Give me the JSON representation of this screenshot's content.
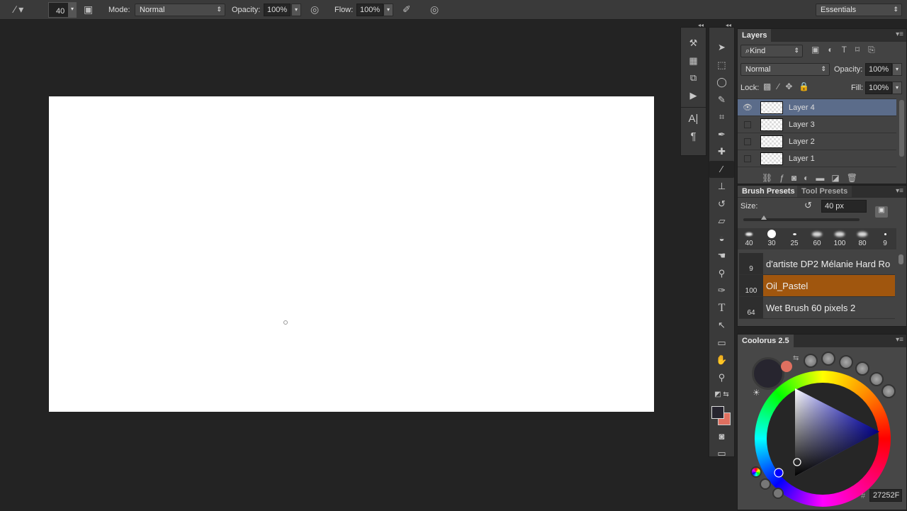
{
  "options_bar": {
    "brush_size": "40",
    "mode_label": "Mode:",
    "mode_value": "Normal",
    "opacity_label": "Opacity:",
    "opacity_value": "100%",
    "flow_label": "Flow:",
    "flow_value": "100%",
    "workspace": "Essentials"
  },
  "tools": [
    "move",
    "marquee",
    "lasso",
    "quick-selection",
    "crop",
    "eyedropper",
    "healing-brush",
    "brush",
    "clone-stamp",
    "history-brush",
    "eraser",
    "paint-bucket",
    "smudge",
    "dodge",
    "pen",
    "type",
    "path-selection",
    "rectangle",
    "hand",
    "zoom"
  ],
  "mini_panel": [
    "tool-presets",
    "swatches",
    "3d",
    "actions",
    "character",
    "paragraph"
  ],
  "layers": {
    "tab": "Layers",
    "filter": "Kind",
    "blend": "Normal",
    "opacity_label": "Opacity:",
    "opacity": "100%",
    "lock_label": "Lock:",
    "fill_label": "Fill:",
    "fill": "100%",
    "items": [
      {
        "name": "Layer 4",
        "visible": true,
        "selected": true
      },
      {
        "name": "Layer 3",
        "visible": false
      },
      {
        "name": "Layer 2",
        "visible": false
      },
      {
        "name": "Layer 1",
        "visible": false
      }
    ]
  },
  "brush_presets": {
    "tab": "Brush Presets",
    "tab2": "Tool Presets",
    "size_label": "Size:",
    "size_value": "40 px",
    "size_fraction": 0.07,
    "tips": [
      "40",
      "30",
      "25",
      "60",
      "100",
      "80",
      "9"
    ],
    "list": [
      {
        "size": "9",
        "name": "d'artiste DP2 Mélanie Hard Ro"
      },
      {
        "size": "100",
        "name": "Oil_Pastel",
        "selected": true
      },
      {
        "size": "64",
        "name": "Wet Brush 60 pixels 2"
      }
    ]
  },
  "coolorus": {
    "title": "Coolorus 2.5",
    "hash": "#",
    "hex": "27252F",
    "foreground": "#27252F",
    "background": "#E07060"
  }
}
